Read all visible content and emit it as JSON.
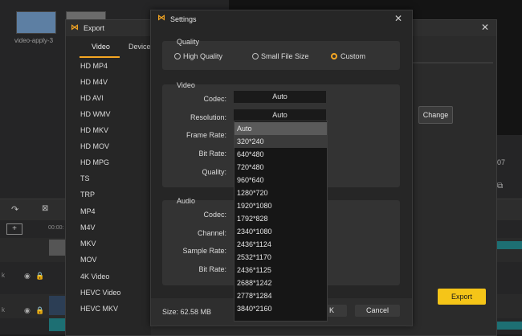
{
  "background": {
    "thumb_label": "video-apply-3",
    "timecode": "00:00:",
    "change_button": "Change",
    "export_button": "Export",
    "side_label_1": "k",
    "side_label_2": "k",
    "counter": "07"
  },
  "export_window": {
    "title": "Export",
    "tabs": [
      "Video",
      "Device"
    ],
    "formats": [
      "HD MP4",
      "HD M4V",
      "HD AVI",
      "HD WMV",
      "HD MKV",
      "HD MOV",
      "HD MPG",
      "TS",
      "TRP",
      "MP4",
      "M4V",
      "MKV",
      "MOV",
      "4K Video",
      "HEVC Video",
      "HEVC MKV"
    ]
  },
  "settings": {
    "title": "Settings",
    "quality": {
      "heading": "Quality",
      "options": [
        "High Quality",
        "Small File Size",
        "Custom"
      ],
      "selected": "Custom"
    },
    "video": {
      "heading": "Video",
      "codec_label": "Codec:",
      "codec_value": "Auto",
      "resolution_label": "Resolution:",
      "resolution_value": "Auto",
      "frame_rate_label": "Frame Rate:",
      "bit_rate_label": "Bit Rate:",
      "quality_label": "Quality:"
    },
    "audio": {
      "heading": "Audio",
      "codec_label": "Codec:",
      "channel_label": "Channel:",
      "sample_rate_label": "Sample Rate:",
      "bit_rate_label": "Bit Rate:"
    },
    "resolution_options": [
      "Auto",
      "320*240",
      "640*480",
      "720*480",
      "960*640",
      "1280*720",
      "1920*1080",
      "1792*828",
      "2340*1080",
      "2436*1124",
      "2532*1170",
      "2436*1125",
      "2688*1242",
      "2778*1284",
      "3840*2160"
    ],
    "resolution_selected": "Auto",
    "resolution_hovered": "320*240",
    "size_text": "Size: 62.58 MB",
    "ok_label": "K",
    "cancel_label": "Cancel"
  },
  "colors": {
    "accent": "#f5a623",
    "timeline": "#1d6f73"
  }
}
